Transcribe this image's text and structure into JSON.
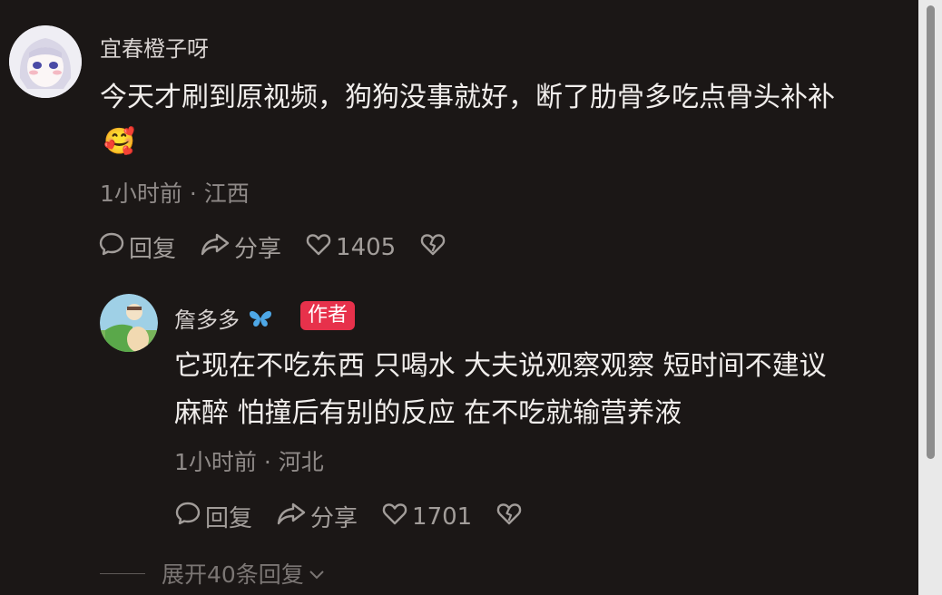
{
  "comment": {
    "username": "宜春橙子呀",
    "text_line1": "今天才刷到原视频，狗狗没事就好，断了肋骨多吃点骨头补补",
    "emoji": "🥰",
    "time": "1小时前",
    "location": "江西",
    "reply_label": "回复",
    "share_label": "分享",
    "likes": "1405"
  },
  "reply": {
    "username": "詹多多",
    "badge": "作者",
    "text_line1": "它现在不吃东西 只喝水 大夫说观察观察 短时间不建议",
    "text_line2": "麻醉 怕撞后有别的反应 在不吃就输营养液",
    "time": "1小时前",
    "location": "河北",
    "reply_label": "回复",
    "share_label": "分享",
    "likes": "1701"
  },
  "expand_replies": "展开40条回复",
  "colors": {
    "background": "#1b1716",
    "badge": "#e7314b",
    "muted": "#a29d9a"
  }
}
